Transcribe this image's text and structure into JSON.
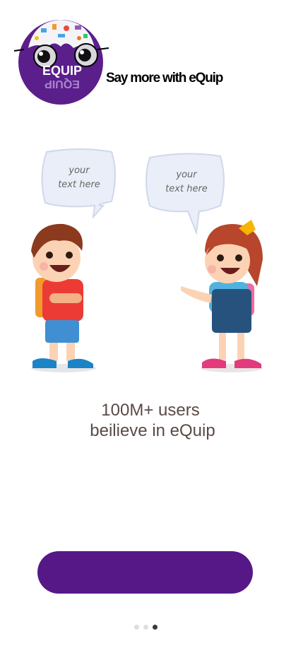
{
  "header": {
    "logo_text": "EQUIP",
    "tagline": "Say more with eQuip"
  },
  "illustration": {
    "bubble_left": [
      "your",
      "text here"
    ],
    "bubble_right": [
      "your",
      "text here"
    ]
  },
  "headline": {
    "line1": "100M+ users",
    "line2": "beilieve in eQuip"
  },
  "cta": {
    "label": ""
  },
  "pager": {
    "total": 3,
    "active": 3
  },
  "colors": {
    "brand_purple": "#561886",
    "logo_purple": "#5b1f8c",
    "text_brown": "#5a4a46",
    "bubble_fill": "#e9eef8",
    "dot_inactive": "#dedede",
    "dot_active": "#3a3a3a"
  }
}
